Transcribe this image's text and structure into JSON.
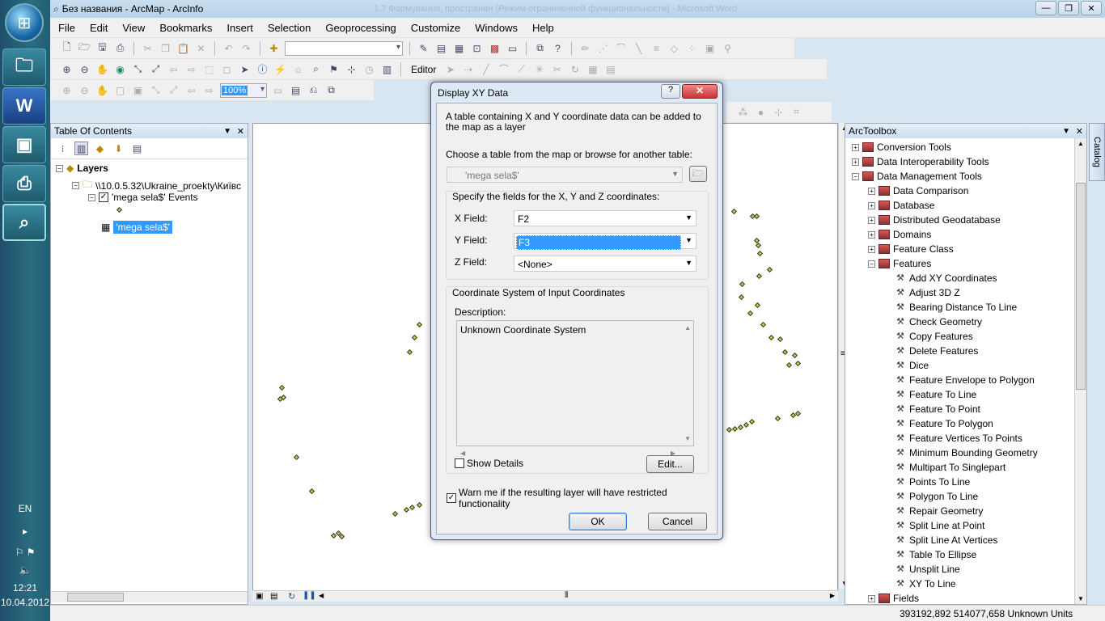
{
  "app": {
    "title": "Без названия - ArcMap - ArcInfo",
    "bg_title": "1.7 Формування, пространен (Режим ограниченной функциональности) - Microsoft Word"
  },
  "menu": [
    "File",
    "Edit",
    "View",
    "Bookmarks",
    "Insert",
    "Selection",
    "Geoprocessing",
    "Customize",
    "Windows",
    "Help"
  ],
  "toolbar": {
    "editor_label": "Editor",
    "zoom_value": "100%"
  },
  "toc": {
    "title": "Table Of Contents",
    "layers_label": "Layers",
    "folder_label": "\\\\10.0.5.32\\Ukraine_proekty\\Київс",
    "events_label": "'mega sela$' Events",
    "table_label": "'mega sela$'"
  },
  "toolbox": {
    "title": "ArcToolbox",
    "catalog_tab": "Catalog",
    "top_items": [
      "Conversion Tools",
      "Data Interoperability Tools",
      "Data Management Tools"
    ],
    "dm_items": [
      "Data Comparison",
      "Database",
      "Distributed Geodatabase",
      "Domains",
      "Feature Class",
      "Features"
    ],
    "feature_tools": [
      "Add XY Coordinates",
      "Adjust 3D Z",
      "Bearing Distance To Line",
      "Check Geometry",
      "Copy Features",
      "Delete Features",
      "Dice",
      "Feature Envelope to Polygon",
      "Feature To Line",
      "Feature To Point",
      "Feature To Polygon",
      "Feature Vertices To Points",
      "Minimum Bounding Geometry",
      "Multipart To Singlepart",
      "Points To Line",
      "Polygon To Line",
      "Repair Geometry",
      "Split Line at Point",
      "Split Line At Vertices",
      "Table To Ellipse",
      "Unsplit Line",
      "XY To Line"
    ],
    "last_item": "Fields"
  },
  "dialog": {
    "title": "Display XY Data",
    "help_label": "?",
    "intro": "A table containing X and Y coordinate data can be added to the map as a layer",
    "choose_label": "Choose a table from the map or browse for another table:",
    "table_value": "'mega sela$'",
    "fields_group": "Specify the fields for the X, Y and Z coordinates:",
    "x_label": "X Field:",
    "x_value": "F2",
    "y_label": "Y Field:",
    "y_value": "F3",
    "z_label": "Z Field:",
    "z_value": "<None>",
    "coord_group": "Coordinate System of Input Coordinates",
    "desc_label": "Description:",
    "desc_value": "Unknown Coordinate System",
    "show_details": "Show Details",
    "edit_button": "Edit...",
    "warn_label": "Warn me if the resulting layer will have restricted functionality",
    "ok_button": "OK",
    "cancel_button": "Cancel"
  },
  "status": {
    "coords": "393192,892  514077,658 Unknown Units"
  },
  "tray": {
    "lang": "EN",
    "time": "12:21",
    "date": "10.04.2012"
  }
}
